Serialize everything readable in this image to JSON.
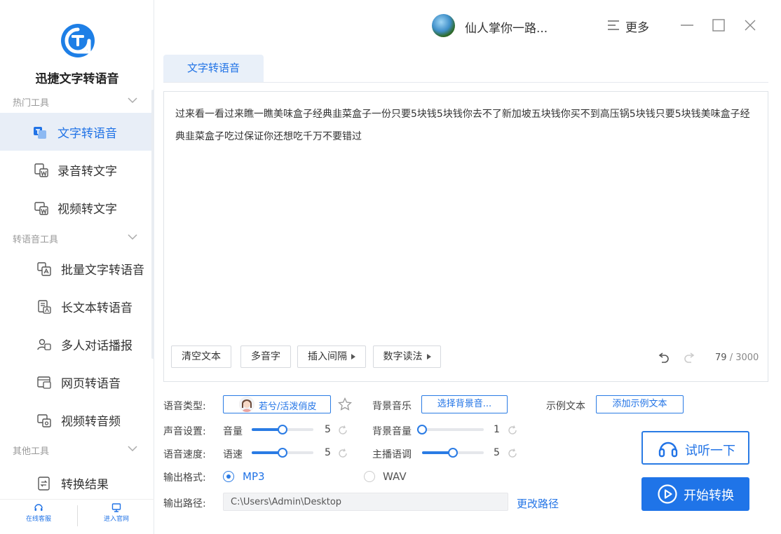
{
  "app": {
    "name": "迅捷文字转语音"
  },
  "sidebar": {
    "sections": [
      {
        "title": "热门工具"
      },
      {
        "title": "转语音工具"
      },
      {
        "title": "其他工具"
      }
    ],
    "items": [
      {
        "label": "文字转语音",
        "icon": "text-to-speech-icon"
      },
      {
        "label": "录音转文字",
        "icon": "audio-to-text-icon"
      },
      {
        "label": "视频转文字",
        "icon": "video-to-text-icon"
      },
      {
        "label": "批量文字转语音",
        "icon": "batch-convert-icon"
      },
      {
        "label": "长文本转语音",
        "icon": "long-text-icon"
      },
      {
        "label": "多人对话播报",
        "icon": "multi-speaker-icon"
      },
      {
        "label": "网页转语音",
        "icon": "webpage-icon"
      },
      {
        "label": "视频转音频",
        "icon": "video-to-audio-icon"
      },
      {
        "label": "转换结果",
        "icon": "results-icon"
      }
    ],
    "bottom": {
      "support": "在线客服",
      "website": "进入官网"
    }
  },
  "header": {
    "username": "仙人掌你一路...",
    "more": "更多"
  },
  "tabs": [
    {
      "label": "文字转语音",
      "active": true
    }
  ],
  "editor": {
    "text": "过来看一看过来瞧一瞧美味盒子经典韭菜盒子一份只要5块钱5块钱你去不了新加坡五块钱你买不到高压锅5块钱只要5块钱美味盒子经典韭菜盒子吃过保证你还想吃千万不要错过",
    "buttons": {
      "clear": "清空文本",
      "polyphone": "多音字",
      "pause": "插入间隔",
      "number": "数字读法"
    },
    "count": "79",
    "limit": "/ 3000"
  },
  "settings": {
    "voice_type_label": "语音类型:",
    "voice_name": "若兮/活泼俏皮",
    "bgm_label": "背景音乐",
    "bgm_button": "选择背景音...",
    "sample_label": "示例文本",
    "sample_button": "添加示例文本",
    "sound_label": "声音设置:",
    "volume_label": "音量",
    "volume_value": "5",
    "volume_level": 0.5,
    "bgm_volume_label": "背景音量",
    "bgm_volume_value": "1",
    "bgm_volume_level": 0.0,
    "speed_label": "语音速度:",
    "rate_label": "语速",
    "rate_value": "5",
    "rate_level": 0.5,
    "pitch_label": "主播语调",
    "pitch_value": "5",
    "pitch_level": 0.5,
    "format_label": "输出格式:",
    "formats": [
      {
        "label": "MP3",
        "selected": true
      },
      {
        "label": "WAV",
        "selected": false
      }
    ],
    "path_label": "输出路径:",
    "path_value": "C:\\Users\\Admin\\Desktop",
    "change_path": "更改路径"
  },
  "actions": {
    "listen": "试听一下",
    "start": "开始转换"
  },
  "colors": {
    "accent": "#2173e6",
    "active_bg": "#e8eef7"
  }
}
